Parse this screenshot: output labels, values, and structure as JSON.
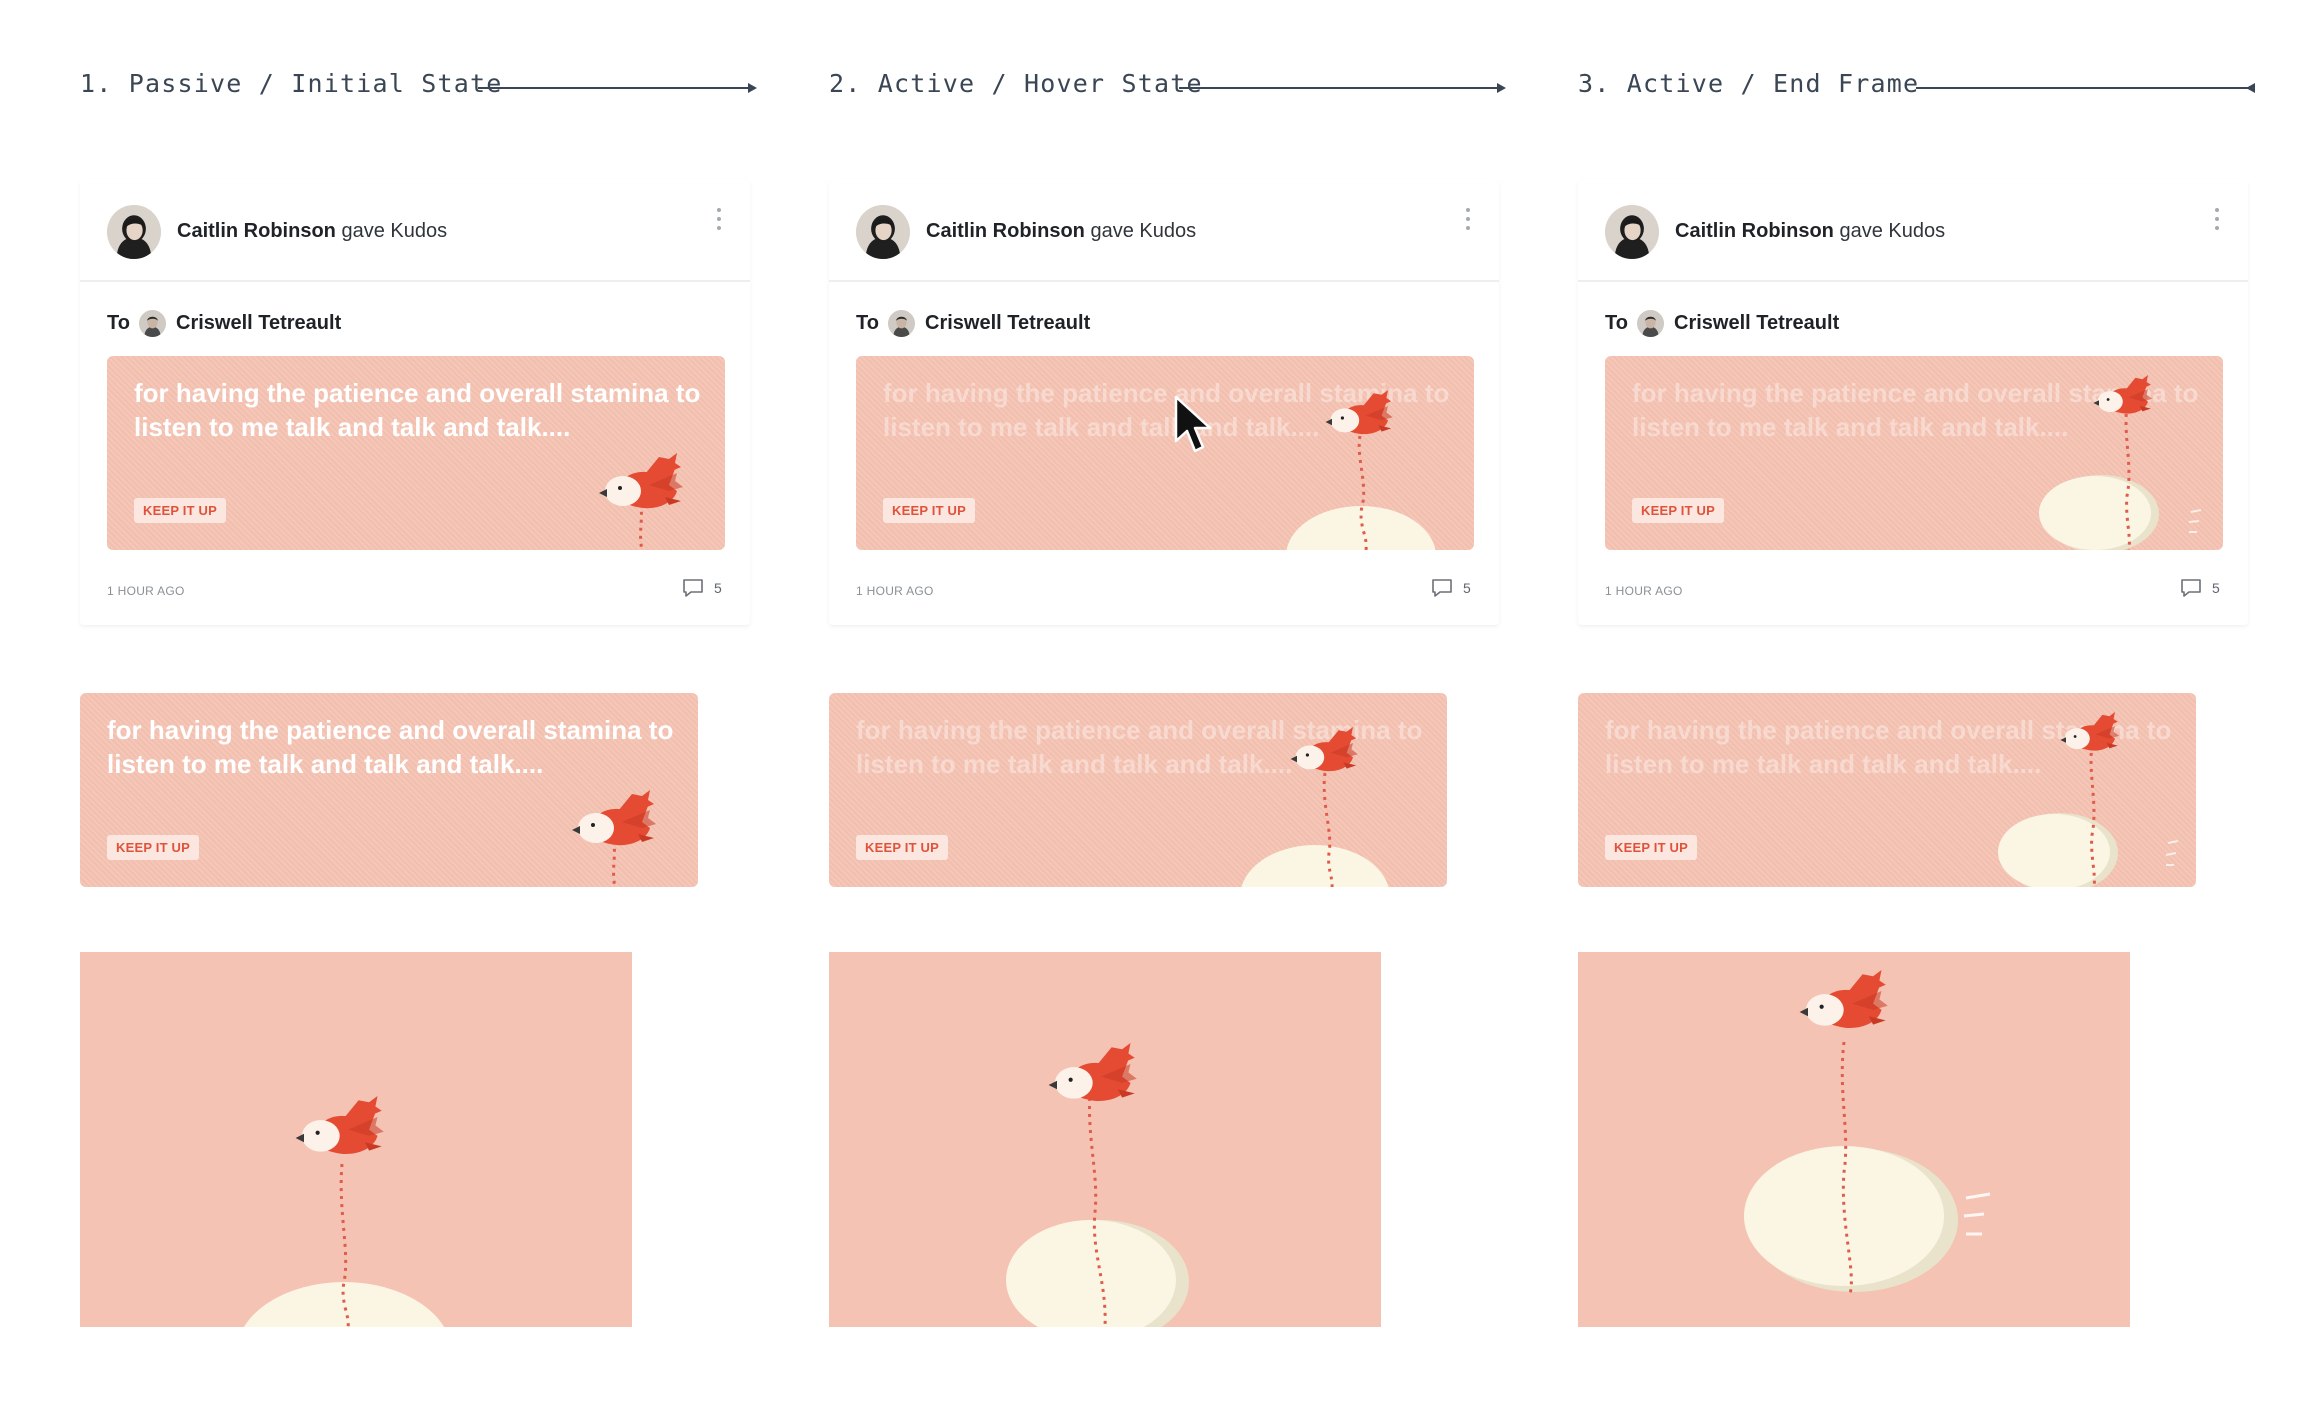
{
  "stages": [
    {
      "title": "1. Passive / Initial State",
      "card": {
        "giver_name": "Caitlin Robinson",
        "giver_action": "gave Kudos",
        "to_label": "To",
        "recipient_name": "Criswell Tetreault",
        "message": "for having the patience and overall stamina to listen to me talk and talk and talk....",
        "tag": "KEEP IT UP",
        "timestamp": "1 HOUR AGO",
        "comment_count": "5"
      },
      "banner": {
        "message": "for having the patience and overall stamina to listen to me talk and talk and talk....",
        "tag": "KEEP IT UP"
      }
    },
    {
      "title": "2. Active / Hover State",
      "card": {
        "giver_name": "Caitlin Robinson",
        "giver_action": "gave Kudos",
        "to_label": "To",
        "recipient_name": "Criswell Tetreault",
        "message": "for having the patience and overall stamina to listen to me talk and talk and talk....",
        "tag": "KEEP IT UP",
        "timestamp": "1 HOUR AGO",
        "comment_count": "5"
      },
      "banner": {
        "message": "for having the patience and overall stamina to listen to me talk and talk and talk....",
        "tag": "KEEP IT UP"
      }
    },
    {
      "title": "3. Active / End Frame",
      "card": {
        "giver_name": "Caitlin Robinson",
        "giver_action": "gave Kudos",
        "to_label": "To",
        "recipient_name": "Criswell Tetreault",
        "message": "for having the patience and overall stamina to listen to me talk and talk and talk....",
        "tag": "KEEP IT UP",
        "timestamp": "1 HOUR AGO",
        "comment_count": "5"
      },
      "banner": {
        "message": "for having the patience and overall stamina to listen to me talk and talk and talk....",
        "tag": "KEEP IT UP"
      }
    }
  ],
  "icons": {
    "menu": "more-vertical-icon",
    "comment": "comment-icon",
    "cursor": "mouse-pointer-icon"
  },
  "colors": {
    "card_background": "#f5c3b3",
    "bird": "#e54b33",
    "egg": "#fbf6e3",
    "tag_text": "#e0523a",
    "stage_title": "#3a4654"
  }
}
